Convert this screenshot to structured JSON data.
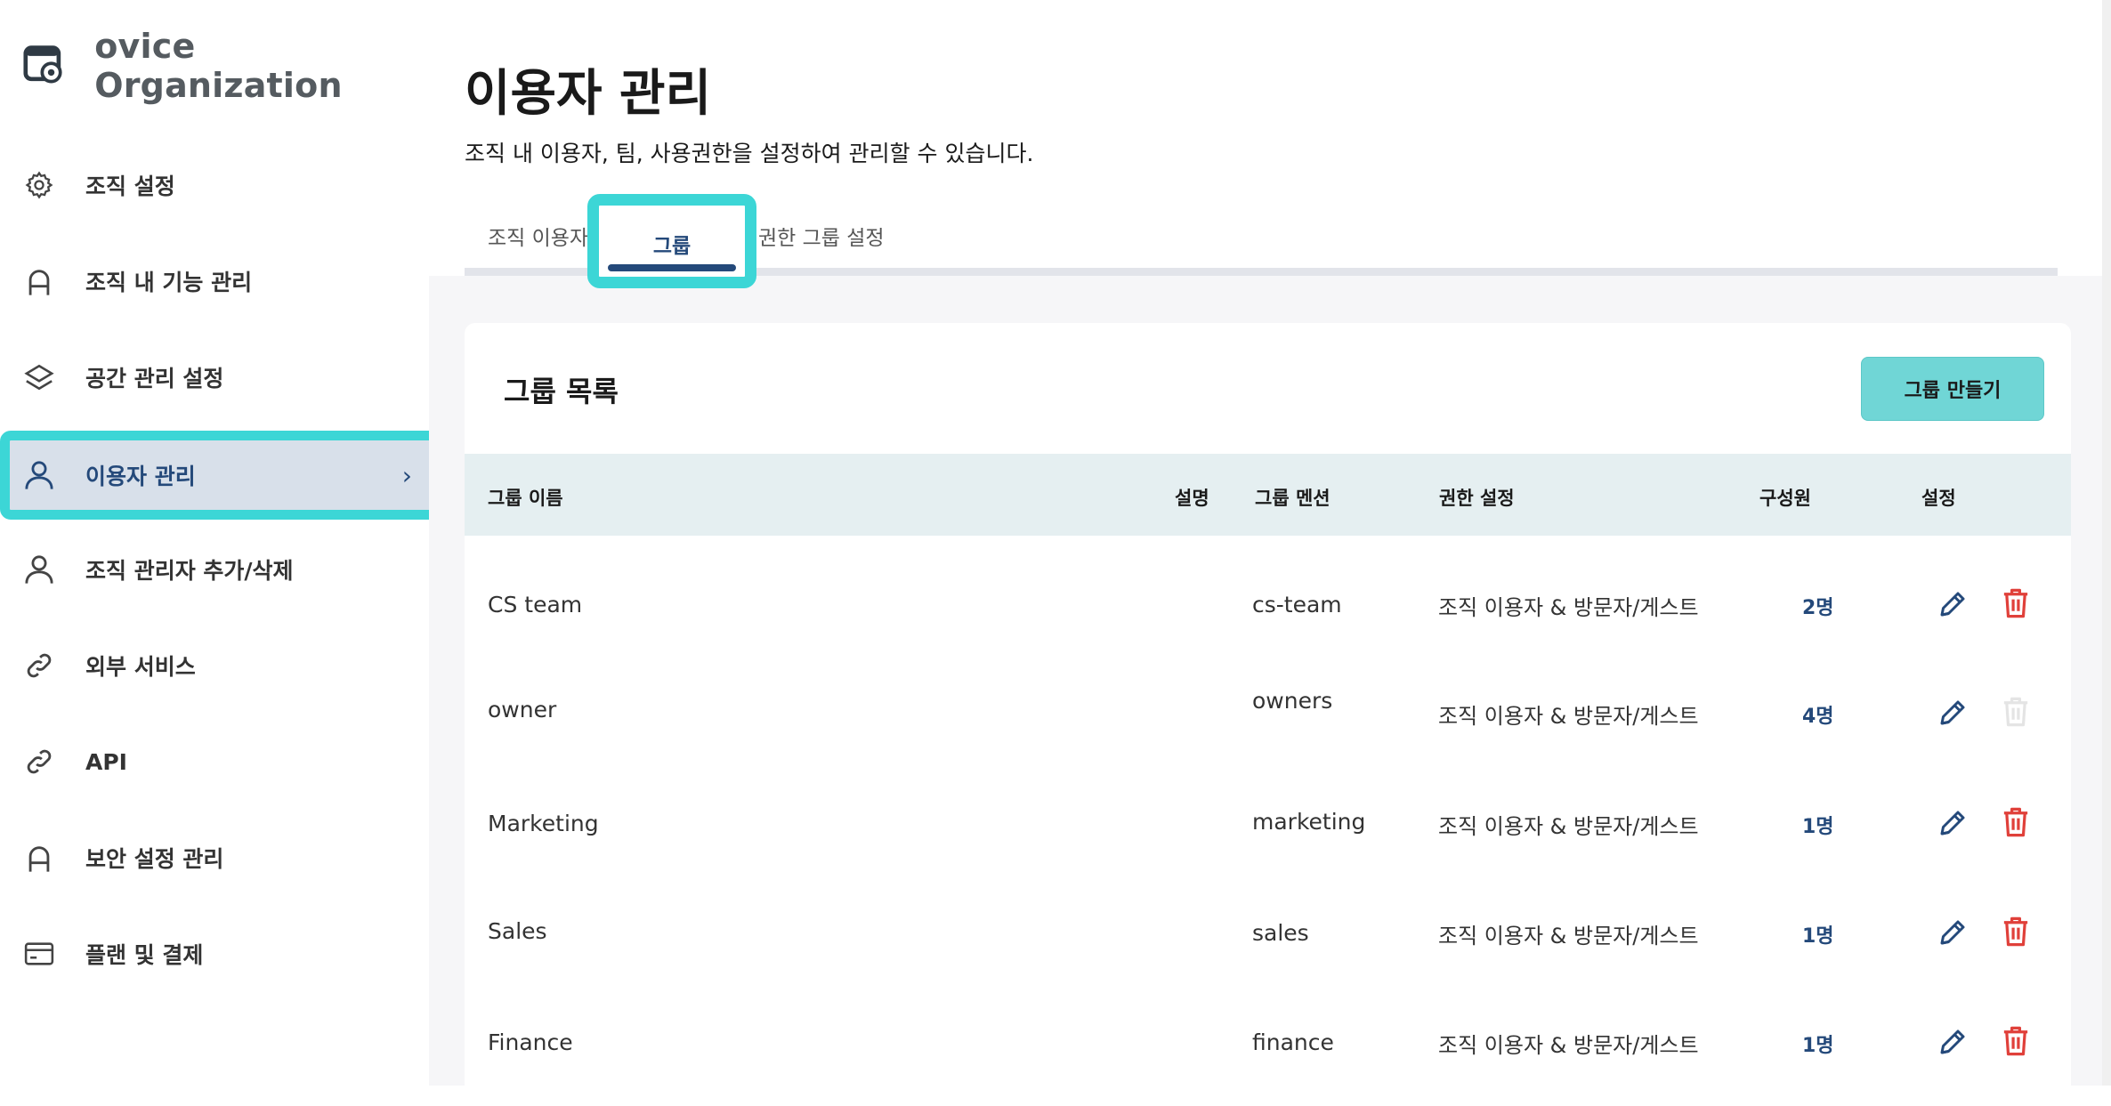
{
  "sidebar": {
    "org_name": "ovice Organization",
    "items": [
      {
        "label": "조직 설정",
        "icon": "gear-icon"
      },
      {
        "label": "조직 내 기능 관리",
        "icon": "lock-icon"
      },
      {
        "label": "공간 관리 설정",
        "icon": "layers-icon"
      },
      {
        "label": "이용자 관리",
        "icon": "user-icon"
      },
      {
        "label": "조직 관리자 추가/삭제",
        "icon": "user-icon"
      },
      {
        "label": "외부 서비스",
        "icon": "link-icon"
      },
      {
        "label": "API",
        "icon": "link-icon"
      },
      {
        "label": "보안 설정 관리",
        "icon": "lock-icon"
      },
      {
        "label": "플랜 및 결제",
        "icon": "credit-card-icon"
      }
    ],
    "active_chevron": "›"
  },
  "header": {
    "title": "이용자 관리",
    "subtitle": "조직 내 이용자, 팀, 사용권한을 설정하여 관리할 수 있습니다."
  },
  "tabs": [
    {
      "label": "조직 이용자"
    },
    {
      "label": "그룹"
    },
    {
      "label": "권한 그룹 설정"
    }
  ],
  "groups": {
    "title": "그룹 목록",
    "create_label": "그룹 만들기",
    "columns": [
      "그룹 이름",
      "설명",
      "그룹 멘션",
      "권한 설정",
      "구성원",
      "설정"
    ],
    "rows": [
      {
        "name": "CS team",
        "mention": "cs-team",
        "permission": "조직 이용자 & 방문자/게스트",
        "members": "2명",
        "deletable": true
      },
      {
        "name": "owner",
        "mention": "owners",
        "permission": "조직 이용자 & 방문자/게스트",
        "members": "4명",
        "deletable": false
      },
      {
        "name": "Marketing",
        "mention": "marketing",
        "permission": "조직 이용자 & 방문자/게스트",
        "members": "1명",
        "deletable": true
      },
      {
        "name": "Sales",
        "mention": "sales",
        "permission": "조직 이용자 & 방문자/게스트",
        "members": "1명",
        "deletable": true
      },
      {
        "name": "Finance",
        "mention": "finance",
        "permission": "조직 이용자 & 방문자/게스트",
        "members": "1명",
        "deletable": true
      }
    ]
  },
  "colors": {
    "accent": "#24497a",
    "highlight": "#3cd6d6",
    "danger": "#e0403a",
    "button": "#70d6d6"
  }
}
